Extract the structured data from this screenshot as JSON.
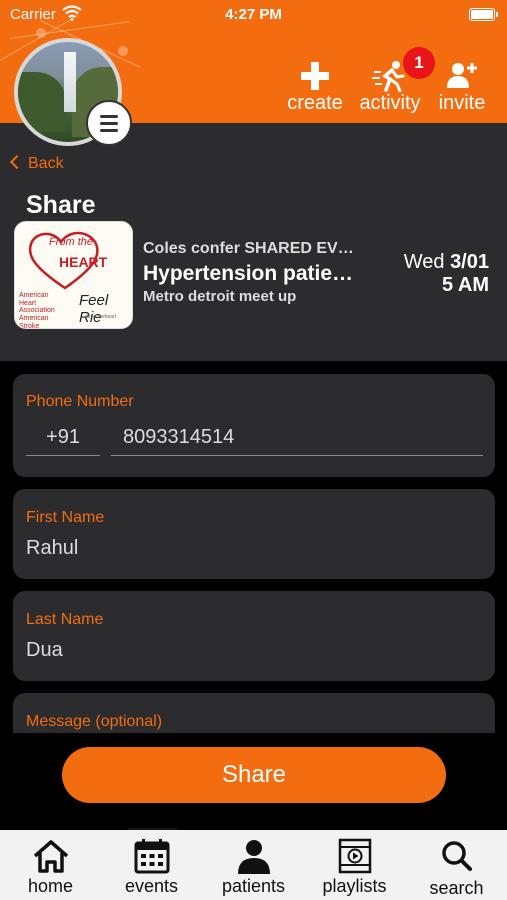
{
  "status": {
    "carrier": "Carrier",
    "time": "4:27 PM"
  },
  "header": {
    "create_label": "create",
    "activity_label": "activity",
    "activity_badge": "1",
    "invite_label": "invite",
    "accent_color": "#f36d10"
  },
  "share": {
    "back_label": "Back",
    "title": "Share",
    "event": {
      "line1": "Coles confer SHARED EV…",
      "line2": "Hypertension patie…",
      "line3": "Metro detroit meet up",
      "day": "Wed",
      "date": "3/01",
      "time": "5 AM"
    },
    "thumbnail": {
      "text1": "From the",
      "text2": "HEART",
      "org": "American Heart Association American Stroke Association",
      "script": "Feel Rie",
      "tag": "#fromtheheart"
    }
  },
  "form": {
    "phone_label": "Phone Number",
    "country_code": "+91",
    "phone_value": "8093314514",
    "first_name_label": "First Name",
    "first_name_value": "Rahul",
    "last_name_label": "Last Name",
    "last_name_value": "Dua",
    "message_label": "Message (optional)"
  },
  "share_button_label": "Share",
  "tabs": [
    {
      "label": "home",
      "icon": "home-icon"
    },
    {
      "label": "events",
      "icon": "calendar-icon"
    },
    {
      "label": "patients",
      "icon": "person-icon"
    },
    {
      "label": "playlists",
      "icon": "playlist-icon"
    },
    {
      "label": "search",
      "icon": "search-icon"
    }
  ]
}
